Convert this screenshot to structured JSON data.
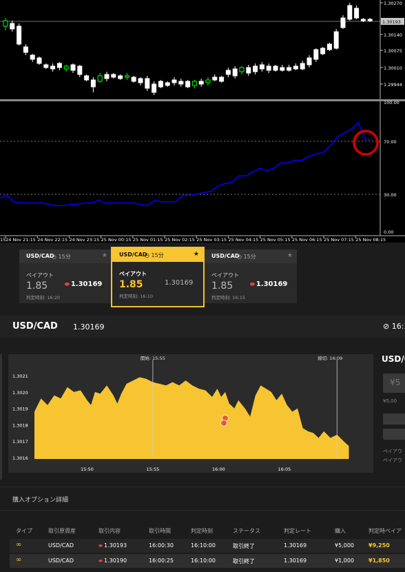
{
  "mt4": {
    "price_labels": [
      "1.30270",
      "1.30193",
      "1.30140",
      "1.30075",
      "1.30010",
      "1.29944"
    ],
    "current_price": "1.30193",
    "osc_labels": [
      "100.00",
      "70.00",
      "30.00",
      "0.00"
    ],
    "time_labels": [
      "24 Nov 21:15",
      "24 Nov 22:15",
      "24 Nov 23:15",
      "25 Nov 00:15",
      "25 Nov 01:15",
      "25 Nov 02:15",
      "25 Nov 03:15",
      "25 Nov 04:15",
      "25 Nov 05:15",
      "25 Nov 06:15",
      "25 Nov 07:15",
      "25 Nov 08:15"
    ],
    "colors": {
      "bull": "#00ff00",
      "bear": "#ffffff",
      "oscillator": "#0000ff",
      "highlight_circle": "#d40000"
    }
  },
  "cards": [
    {
      "pair": "USD/CAD",
      "duration": "15分",
      "payout_label": "ペイアウト",
      "payout": "1.85",
      "rate": "1.30169",
      "expiry": "判定時刻: 16:20",
      "selected": false
    },
    {
      "pair": "USD/CAD",
      "duration": "15分",
      "payout_label": "ペイアウト",
      "payout": "1.85",
      "rate": "1.30169",
      "expiry": "判定時刻: 16:10",
      "selected": true
    },
    {
      "pair": "USD/CAD",
      "duration": "15分",
      "payout_label": "ペイアウト",
      "payout": "1.85",
      "rate": "1.30169",
      "expiry": "判定時刻: 16:15",
      "selected": false
    }
  ],
  "header": {
    "symbol": "USD/CAD",
    "price": "1.30169",
    "clock": "16:1"
  },
  "chart": {
    "y_labels": [
      "1.3021",
      "1.3020",
      "1.3019",
      "1.3018",
      "1.3017",
      "1.3016"
    ],
    "x_labels": [
      "15:50",
      "15:55",
      "16:00",
      "16:05"
    ],
    "start_label": "開始: 15:55",
    "cutoff_label": "締切: 16:09",
    "colors": {
      "area": "#f7c531",
      "marker": "#e65c2c"
    }
  },
  "right_panel": {
    "title": "USD/C",
    "amount": "¥5",
    "sub_amount": "¥5,00",
    "payout_label_1": "ペイアウ",
    "payout_label_2": "ペイアウ"
  },
  "details": {
    "title": "購入オプション詳細",
    "headers": [
      "タイプ",
      "取引原資産",
      "取引内容",
      "取引時間",
      "判定時刻",
      "ステータス",
      "判定レート",
      "購入",
      "判定時ペイア"
    ],
    "rows": [
      {
        "asset": "USD/CAD",
        "content": "1.30193",
        "time": "16:00:30",
        "judge": "16:10:00",
        "status": "取引終了",
        "rate": "1.30169",
        "buy": "¥5,000",
        "payout": "¥9,250"
      },
      {
        "asset": "USD/CAD",
        "content": "1.30190",
        "time": "16:00:25",
        "judge": "16:10:00",
        "status": "取引終了",
        "rate": "1.30169",
        "buy": "¥1,000",
        "payout": "¥1,850"
      }
    ]
  }
}
